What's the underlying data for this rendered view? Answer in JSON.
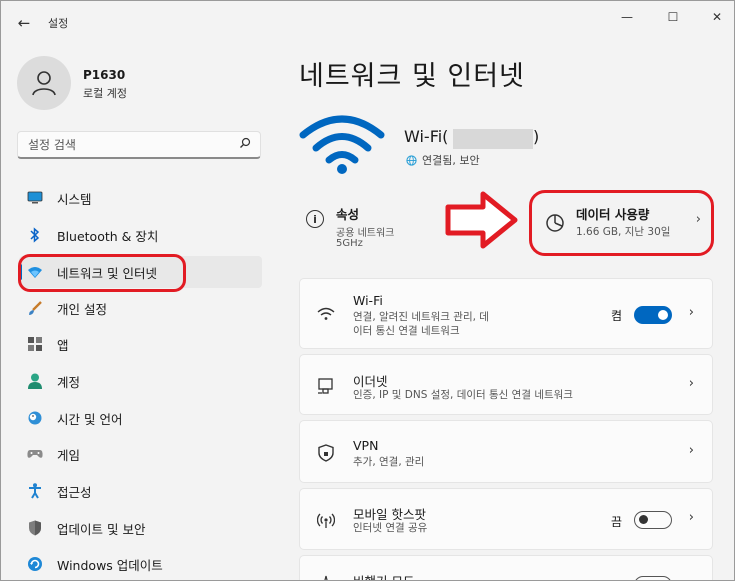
{
  "window": {
    "app_title": "설정",
    "back_glyph": "←",
    "min_glyph": "—",
    "max_glyph": "☐",
    "close_glyph": "✕"
  },
  "profile": {
    "name": "P1630",
    "account_type": "로컬 계정"
  },
  "search": {
    "placeholder": "설정 검색"
  },
  "sidebar": {
    "items": [
      {
        "label": "시스템",
        "icon": "monitor-icon"
      },
      {
        "label": "Bluetooth & 장치",
        "icon": "bluetooth-icon"
      },
      {
        "label": "네트워크 및 인터넷",
        "icon": "wifi-icon",
        "active": true
      },
      {
        "label": "개인 설정",
        "icon": "brush-icon"
      },
      {
        "label": "앱",
        "icon": "apps-icon"
      },
      {
        "label": "계정",
        "icon": "account-icon"
      },
      {
        "label": "시간 및 언어",
        "icon": "clock-globe-icon"
      },
      {
        "label": "게임",
        "icon": "gamepad-icon"
      },
      {
        "label": "접근성",
        "icon": "accessibility-icon"
      },
      {
        "label": "업데이트 및 보안",
        "icon": "shield-icon"
      },
      {
        "label": "Windows 업데이트",
        "icon": "update-icon"
      }
    ]
  },
  "main": {
    "page_title": "네트워크 및 인터넷",
    "connection": {
      "name_prefix": "Wi-Fi(",
      "name_suffix": ")",
      "status": "연결됨, 보안"
    },
    "properties": {
      "title": "속성",
      "network_type": "공용 네트워크",
      "band": "5GHz"
    },
    "data_usage": {
      "title": "데이터 사용량",
      "detail": "1.66 GB, 지난 30일"
    },
    "cards": {
      "wifi": {
        "title": "Wi-Fi",
        "desc_line1": "연결, 알려진 네트워크 관리, 데",
        "desc_line2": "이터 통신 연결 네트워크",
        "toggle_state": "켬"
      },
      "ethernet": {
        "title": "이더넷",
        "desc": "인증, IP 및 DNS 설정, 데이터 통신 연결 네트워크"
      },
      "vpn": {
        "title": "VPN",
        "desc": "추가, 연결, 관리"
      },
      "hotspot": {
        "title": "모바일 핫스팟",
        "desc": "인터넷 연결 공유",
        "toggle_state": "끔"
      },
      "airplane": {
        "title": "비행기 모드"
      }
    },
    "chevron_glyph": "›"
  },
  "colors": {
    "accent": "#0067c0",
    "annotation_red": "#e21b23",
    "background": "#f3f3f3",
    "card": "#fbfbfb"
  }
}
